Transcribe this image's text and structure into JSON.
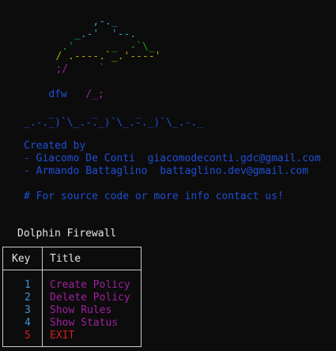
{
  "banner": {
    "art_lines": [
      {
        "segments": [
          {
            "text": "               ,-._",
            "color": "#2aa1b3"
          }
        ]
      },
      {
        "segments": [
          {
            "text": "            _.-'  '--.",
            "color": "#2aa1b3"
          }
        ]
      },
      {
        "segments": [
          {
            "text": "          .'      _  -`\\_",
            "color": "#16a016"
          }
        ]
      },
      {
        "segments": [
          {
            "text": "         / .----.`_.'----'",
            "color": "#b8a800"
          }
        ]
      },
      {
        "segments": [
          {
            "text": "         ;/     `",
            "color": "#a020a0"
          }
        ]
      }
    ],
    "dfw_label": "dfw",
    "dfw_art": "/_;",
    "waves": [
      "    _      _      _",
      "_.-._)`\\_.-._)`\\_.-._)`\\_.-._"
    ]
  },
  "credits": {
    "created_by": "Created by",
    "authors": [
      {
        "prefix": "- ",
        "name": "Giacomo De Conti",
        "email": "giacomodeconti.gdc@gmail.com"
      },
      {
        "prefix": "- ",
        "name": "Armando Battaglino",
        "email": "battaglino.dev@gmail.com"
      }
    ],
    "contact_note": "# For source code or more info contact us!"
  },
  "menu": {
    "title": "Dolphin Firewall",
    "header_key": "Key",
    "header_title": "Title",
    "items": [
      {
        "key": "1",
        "label": "Create Policy",
        "key_color": "#3a96dd",
        "label_color": "#a020a0"
      },
      {
        "key": "2",
        "label": "Delete Policy",
        "key_color": "#3a96dd",
        "label_color": "#a020a0"
      },
      {
        "key": "3",
        "label": "Show Rules",
        "key_color": "#3a96dd",
        "label_color": "#a020a0"
      },
      {
        "key": "4",
        "label": "Show Status",
        "key_color": "#3a96dd",
        "label_color": "#a020a0"
      },
      {
        "key": "5",
        "label": "EXIT",
        "key_color": "#d21f1f",
        "label_color": "#d21f1f"
      }
    ]
  },
  "colors": {
    "background": "#0c0c0c",
    "text_blue": "#1f4fd6",
    "text_white": "#e6e6e6",
    "border": "#cccccc"
  }
}
